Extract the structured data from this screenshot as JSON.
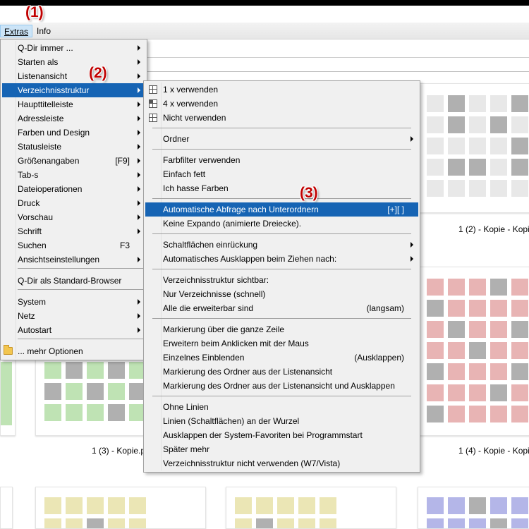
{
  "menubar": {
    "items": [
      {
        "label": "Extras"
      },
      {
        "label": "Info"
      }
    ]
  },
  "callouts": {
    "c1": "(1)",
    "c2": "(2)",
    "c3": "(3)"
  },
  "main_menu": {
    "items": [
      {
        "label": "Q-Dir immer ...",
        "shortcut": ""
      },
      {
        "label": "Starten als",
        "shortcut": ""
      },
      {
        "label": "Listenansicht",
        "shortcut": ""
      },
      {
        "label": "Verzeichnisstruktur",
        "shortcut": ""
      },
      {
        "label": "Haupttitelleiste",
        "shortcut": ""
      },
      {
        "label": "Adressleiste",
        "shortcut": ""
      },
      {
        "label": "Farben und Design",
        "shortcut": ""
      },
      {
        "label": "Statusleiste",
        "shortcut": ""
      },
      {
        "label": "Größenangaben",
        "shortcut": "[F9]"
      },
      {
        "label": "Tab-s",
        "shortcut": ""
      },
      {
        "label": "Dateioperationen",
        "shortcut": ""
      },
      {
        "label": "Druck",
        "shortcut": ""
      },
      {
        "label": "Vorschau",
        "shortcut": ""
      },
      {
        "label": "Schrift",
        "shortcut": ""
      },
      {
        "label": "Suchen",
        "shortcut": "F3"
      },
      {
        "label": "Ansichtseinstellungen",
        "shortcut": ""
      },
      {
        "label": "Q-Dir als Standard-Browser",
        "shortcut": ""
      },
      {
        "label": "System",
        "shortcut": ""
      },
      {
        "label": "Netz",
        "shortcut": ""
      },
      {
        "label": "Autostart",
        "shortcut": ""
      },
      {
        "label": "... mehr Optionen",
        "shortcut": ""
      }
    ]
  },
  "sub_menu": {
    "items": [
      {
        "label": "1 x verwenden",
        "shortcut": ""
      },
      {
        "label": "4 x verwenden",
        "shortcut": ""
      },
      {
        "label": "Nicht verwenden",
        "shortcut": ""
      },
      {
        "label": "Ordner",
        "shortcut": ""
      },
      {
        "label": "Farbfilter verwenden",
        "shortcut": ""
      },
      {
        "label": "Einfach fett",
        "shortcut": ""
      },
      {
        "label": "Ich hasse Farben",
        "shortcut": ""
      },
      {
        "label": "Automatische Abfrage nach Unterordnern",
        "shortcut": "[+][ ]"
      },
      {
        "label": "Keine Expando (animierte Dreiecke).",
        "shortcut": ""
      },
      {
        "label": "Schaltflächen einrückung",
        "shortcut": ""
      },
      {
        "label": "Automatisches Ausklappen beim Ziehen nach:",
        "shortcut": ""
      },
      {
        "label": "Verzeichnisstruktur sichtbar:",
        "shortcut": ""
      },
      {
        "label": "Nur Verzeichnisse (schnell)",
        "shortcut": ""
      },
      {
        "label": "Alle die erweiterbar sind",
        "shortcut": "(langsam)"
      },
      {
        "label": "Markierung über die ganze Zeile",
        "shortcut": ""
      },
      {
        "label": "Erweitern beim Anklicken mit der Maus",
        "shortcut": ""
      },
      {
        "label": "Einzelnes Einblenden",
        "shortcut": "(Ausklappen)"
      },
      {
        "label": "Markierung des Ordner aus der Listenansicht",
        "shortcut": ""
      },
      {
        "label": "Markierung des Ordner aus der Listenansicht und Ausklappen",
        "shortcut": ""
      },
      {
        "label": "Ohne Linien",
        "shortcut": ""
      },
      {
        "label": "Linien (Schaltflächen) an der Wurzel",
        "shortcut": ""
      },
      {
        "label": "Ausklappen der System-Favoriten bei Programmstart",
        "shortcut": ""
      },
      {
        "label": "Später mehr",
        "shortcut": ""
      },
      {
        "label": "Verzeichnisstruktur nicht verwenden (W7/Vista)",
        "shortcut": ""
      }
    ]
  },
  "thumbnails": {
    "captions": [
      "1 (2) - Kopie - Kopi",
      "1 (3) - Kopie.p",
      "1 (4) - Kopie - Kopi"
    ]
  },
  "colors": {
    "highlight": "#1664b4",
    "callout": "#c00000",
    "gray_tile": "#e8e8e8",
    "red_tile": "#e8b4b4",
    "green_tile": "#bfe3b4",
    "yellow_tile": "#ebe6b5",
    "blue_tile": "#b4b6e8"
  },
  "icons": {
    "grid": "grid-layout-icon",
    "folder": "folder-icon",
    "submenu": "submenu-arrow-icon"
  }
}
